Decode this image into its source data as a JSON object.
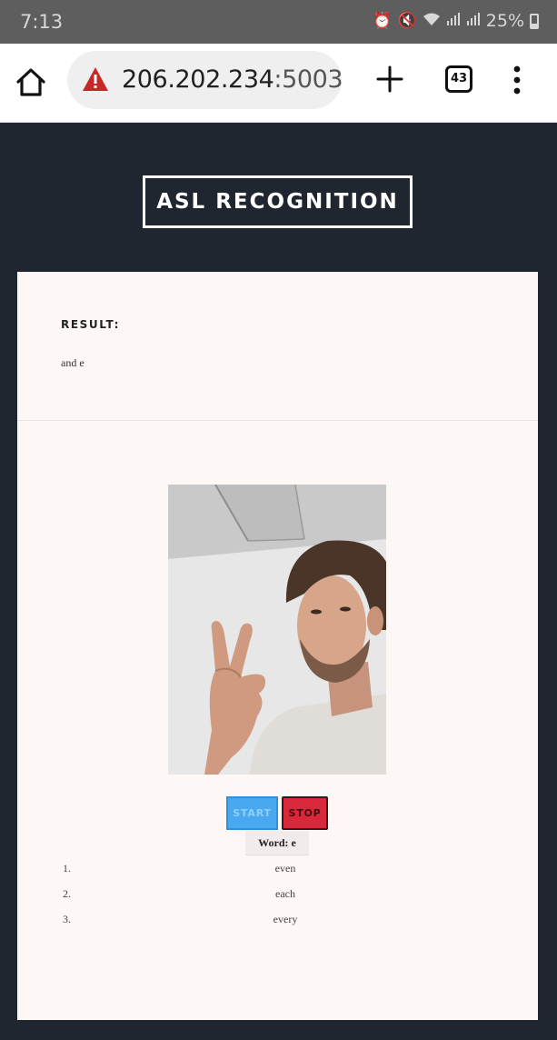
{
  "status_bar": {
    "time": "7:13",
    "battery": "25%"
  },
  "browser": {
    "url_host": "206.202.234",
    "url_port": ":5003",
    "tab_count": "43"
  },
  "page": {
    "title": "ASL RECOGNITION",
    "result_label": "RESULT:",
    "result_text": "and e",
    "start_label": "START",
    "stop_label": "STOP",
    "word_label": "Word: e",
    "suggestions": [
      {
        "num": "1.",
        "text": "even"
      },
      {
        "num": "2.",
        "text": "each"
      },
      {
        "num": "3.",
        "text": "every"
      }
    ]
  },
  "colors": {
    "page_background": "#1f2630",
    "card_background": "#fdf7f6",
    "start_button": "#4aa8f0",
    "stop_button": "#d9283b",
    "warning_icon": "#c62828"
  }
}
